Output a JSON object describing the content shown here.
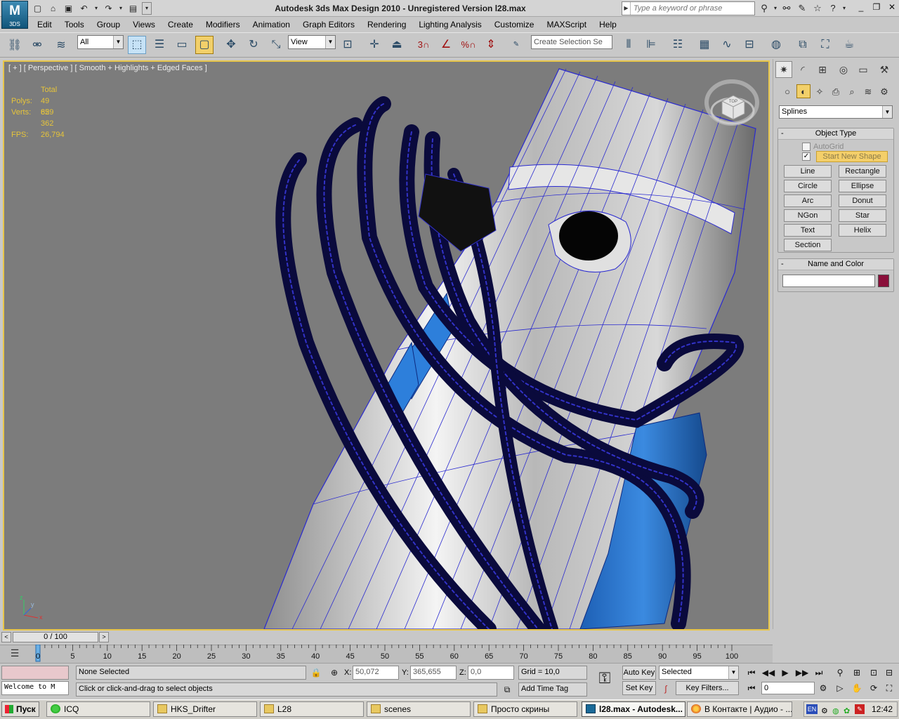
{
  "app": {
    "logo_text": "M",
    "logo_sub": "3DS",
    "window_title": "Autodesk 3ds Max Design 2010    -    Unregistered Version      l28.max"
  },
  "search": {
    "placeholder": "Type a keyword or phrase"
  },
  "menu": [
    "Edit",
    "Tools",
    "Group",
    "Views",
    "Create",
    "Modifiers",
    "Animation",
    "Graph Editors",
    "Rendering",
    "Lighting Analysis",
    "Customize",
    "MAXScript",
    "Help"
  ],
  "toolbar": {
    "filter_value": "All",
    "coord_value": "View",
    "named_selection_placeholder": "Create Selection Se",
    "snap_3": "3",
    "snap_percent": "%"
  },
  "viewport": {
    "label": "[ + ] [ Perspective ] [ Smooth + Highlights + Edged Faces ]",
    "stats": {
      "header": "Total",
      "polys_label": "Polys:",
      "polys_value": "49 859",
      "verts_label": "Verts:",
      "verts_value": "62 362",
      "fps_label": "FPS:",
      "fps_value": "26,794"
    },
    "viewcube_label": "TOP",
    "axis": {
      "x": "x",
      "y": "y",
      "z": "z"
    }
  },
  "command_panel": {
    "category_value": "Splines",
    "object_type": {
      "title": "Object Type",
      "autogrid": "AutoGrid",
      "start_new_shape": "Start New Shape",
      "start_new_checked": "✓",
      "buttons": [
        "Line",
        "Rectangle",
        "Circle",
        "Ellipse",
        "Arc",
        "Donut",
        "NGon",
        "Star",
        "Text",
        "Helix",
        "Section"
      ]
    },
    "name_and_color": {
      "title": "Name and Color",
      "name_value": "",
      "color": "#8a0f3a"
    },
    "minus": "-"
  },
  "timeline": {
    "slider_label": "0 / 100",
    "left_arrow": "<",
    "right_arrow": ">",
    "ticks": [
      "0",
      "5",
      "10",
      "15",
      "20",
      "25",
      "30",
      "35",
      "40",
      "45",
      "50",
      "55",
      "60",
      "65",
      "70",
      "75",
      "80",
      "85",
      "90",
      "95",
      "100"
    ]
  },
  "status": {
    "maxscript_listener": "Welcome to M",
    "selection": "None Selected",
    "prompt": "Click or click-and-drag to select objects",
    "x_label": "X:",
    "x_value": "50,072",
    "y_label": "Y:",
    "y_value": "365,655",
    "z_label": "Z:",
    "z_value": "0,0",
    "grid": "Grid = 10,0",
    "add_time_tag": "Add Time Tag",
    "auto_key": "Auto Key",
    "set_key": "Set Key",
    "key_mode": "Selected",
    "key_filters": "Key Filters...",
    "frame_value": "0"
  },
  "taskbar": {
    "start": "Пуск",
    "tasks": [
      "ICQ",
      "HKS_Drifter",
      "L28",
      "scenes",
      "Просто скрины",
      "l28.max - Autodesk...",
      "В Контакте | Аудио - ..."
    ],
    "lang": "EN",
    "clock": "12:42"
  }
}
